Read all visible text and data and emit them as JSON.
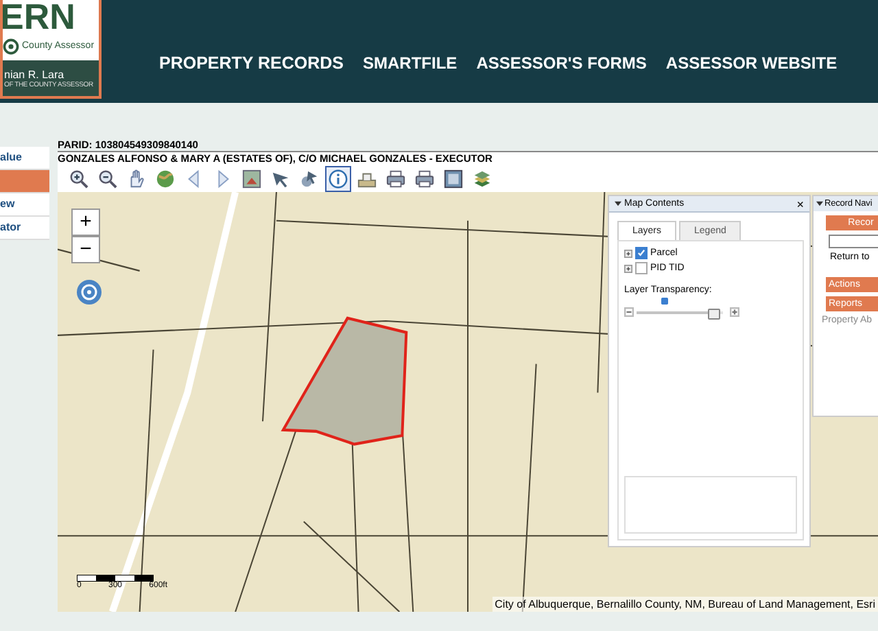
{
  "header": {
    "logo": {
      "wordmark": "ERN",
      "subtitle": "County Assessor",
      "name": "nian R. Lara",
      "tagline": "OF THE COUNTY ASSESSOR"
    },
    "nav": [
      "PROPERTY RECORDS",
      "SMARTFILE",
      "ASSESSOR'S FORMS",
      "ASSESSOR WEBSITE"
    ]
  },
  "sidebar": {
    "items": [
      {
        "label": "alue",
        "selected": false
      },
      {
        "selected": true
      },
      {
        "label": "ew",
        "selected": false
      },
      {
        "label": "ator",
        "selected": false
      }
    ]
  },
  "record": {
    "parid": "PARID: 103804549309840140",
    "owner": "GONZALES ALFONSO & MARY A (ESTATES OF), C/O MICHAEL GONZALES - EXECUTOR"
  },
  "toolbar": {
    "tools": [
      {
        "selected": false
      },
      {
        "selected": false
      },
      {
        "selected": false
      },
      {
        "selected": false
      },
      {
        "selected": false
      },
      {
        "selected": false
      },
      {
        "selected": false
      },
      {
        "selected": false
      },
      {
        "selected": false
      },
      {
        "selected": true
      },
      {
        "selected": false
      },
      {
        "selected": false
      },
      {
        "selected": false
      },
      {
        "selected": false
      },
      {
        "selected": false
      }
    ]
  },
  "map": {
    "zoom_in": "+",
    "zoom_out": "−",
    "scale": [
      "0",
      "300",
      "600ft"
    ],
    "attribution": "City of Albuquerque, Bernalillo County, NM, Bureau of Land Management, Esri"
  },
  "map_contents": {
    "title": "Map Contents",
    "close": "×",
    "tabs": [
      {
        "label": "Layers",
        "selected": true
      },
      {
        "label": "Legend",
        "selected": false
      }
    ],
    "layers": [
      {
        "label": "Parcel",
        "checked": true
      },
      {
        "label": "PID TID",
        "checked": false
      }
    ],
    "transparency": {
      "label": "Layer Transparency:",
      "level": 0.93
    }
  },
  "record_nav": {
    "title": "Record Navi",
    "button": "Recor",
    "return": "Return to",
    "actions": "Actions",
    "reports": "Reports",
    "link": "Property Ab"
  }
}
